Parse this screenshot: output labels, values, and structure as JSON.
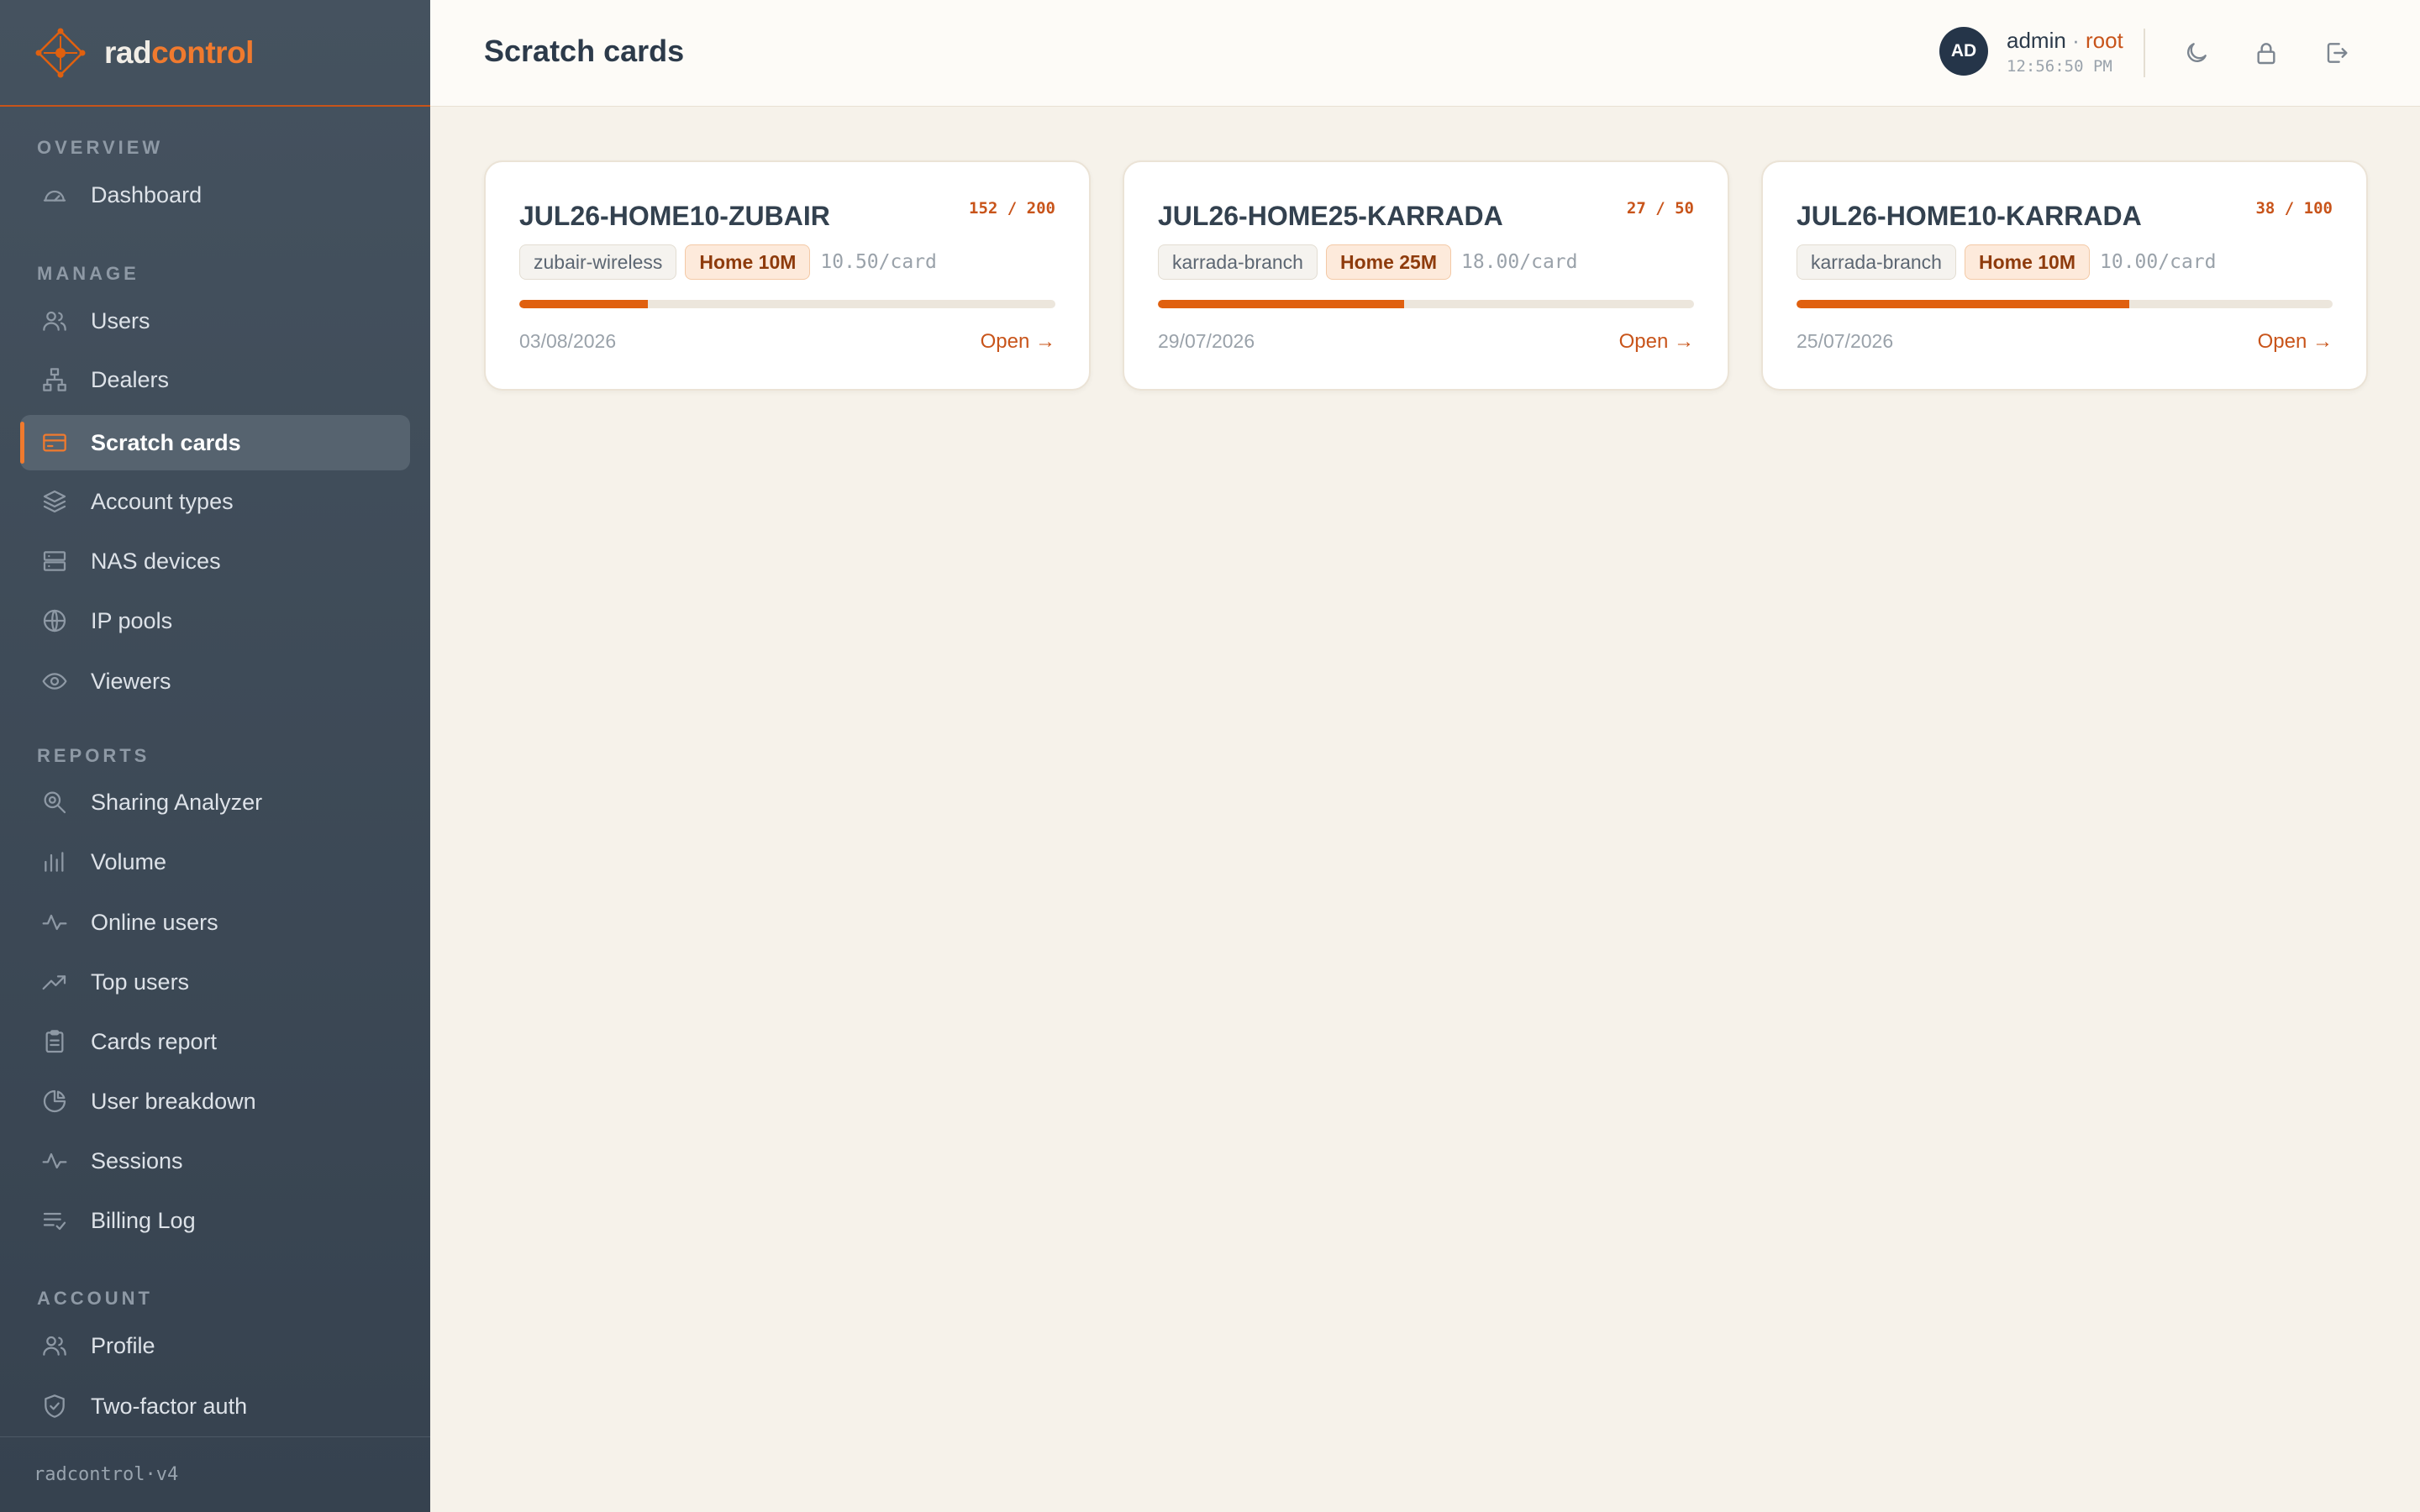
{
  "brand": {
    "part1": "rad",
    "part2": "control"
  },
  "sidebar": {
    "sections": [
      {
        "label": "OVERVIEW",
        "items": [
          {
            "label": "Dashboard",
            "icon": "gauge-icon"
          }
        ]
      },
      {
        "label": "MANAGE",
        "items": [
          {
            "label": "Users",
            "icon": "users-icon"
          },
          {
            "label": "Dealers",
            "icon": "network-icon"
          },
          {
            "label": "Scratch cards",
            "icon": "card-icon",
            "active": true
          },
          {
            "label": "Account types",
            "icon": "layers-icon"
          },
          {
            "label": "NAS devices",
            "icon": "server-icon"
          },
          {
            "label": "IP pools",
            "icon": "globe-icon"
          },
          {
            "label": "Viewers",
            "icon": "eye-icon"
          }
        ]
      },
      {
        "label": "REPORTS",
        "items": [
          {
            "label": "Sharing Analyzer",
            "icon": "search-zoom-icon"
          },
          {
            "label": "Volume",
            "icon": "bar-chart-icon"
          },
          {
            "label": "Online users",
            "icon": "activity-icon"
          },
          {
            "label": "Top users",
            "icon": "trending-up-icon"
          },
          {
            "label": "Cards report",
            "icon": "clipboard-icon"
          },
          {
            "label": "User breakdown",
            "icon": "pie-chart-icon"
          },
          {
            "label": "Sessions",
            "icon": "activity-icon"
          },
          {
            "label": "Billing Log",
            "icon": "list-check-icon"
          }
        ]
      },
      {
        "label": "ACCOUNT",
        "items": [
          {
            "label": "Profile",
            "icon": "users-icon"
          },
          {
            "label": "Two-factor auth",
            "icon": "shield-check-icon"
          }
        ]
      }
    ],
    "footer": "radcontrol·v4"
  },
  "header": {
    "title": "Scratch cards",
    "avatar": "AD",
    "user_name": "admin",
    "separator": "·",
    "user_role": "root",
    "time": "12:56:50 PM"
  },
  "cards": [
    {
      "title": "JUL26-HOME10-ZUBAIR",
      "count": "152 / 200",
      "used": 152,
      "total": 200,
      "dealer": "zubair-wireless",
      "plan": "Home 10M",
      "price": "10.50/card",
      "date": "03/08/2026",
      "open": "Open →"
    },
    {
      "title": "JUL26-HOME25-KARRADA",
      "count": "27 / 50",
      "used": 27,
      "total": 50,
      "dealer": "karrada-branch",
      "plan": "Home 25M",
      "price": "18.00/card",
      "date": "29/07/2026",
      "open": "Open →"
    },
    {
      "title": "JUL26-HOME10-KARRADA",
      "count": "38 / 100",
      "used": 38,
      "total": 100,
      "dealer": "karrada-branch",
      "plan": "Home 10M",
      "price": "10.00/card",
      "date": "25/07/2026",
      "open": "Open →"
    }
  ],
  "progress_remaining": [
    0.24,
    0.46,
    0.62
  ],
  "colors": {
    "accent": "#e0600f",
    "sidebar": "#3e4a57",
    "background": "#f6f2ea"
  }
}
